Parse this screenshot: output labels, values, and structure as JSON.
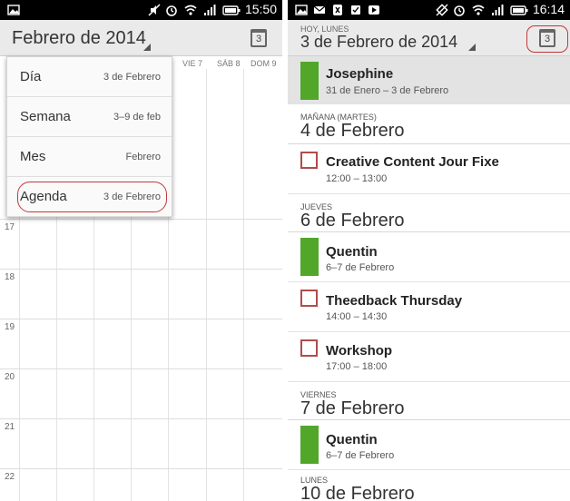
{
  "left": {
    "status": {
      "time": "15:50"
    },
    "header": {
      "title": "Febrero de 2014",
      "today_icon_day": "3"
    },
    "day_headers": [
      "VIE 7",
      "SÁB 8",
      "DOM 9"
    ],
    "hours": [
      "17",
      "18",
      "19",
      "20",
      "21",
      "22"
    ],
    "menu": [
      {
        "label": "Día",
        "value": "3 de Febrero"
      },
      {
        "label": "Semana",
        "value": "3–9 de feb"
      },
      {
        "label": "Mes",
        "value": "Febrero"
      },
      {
        "label": "Agenda",
        "value": "3 de Febrero"
      }
    ]
  },
  "right": {
    "status": {
      "time": "16:14"
    },
    "header": {
      "subtitle": "HOY, LUNES",
      "title": "3 de Febrero de 2014",
      "today_icon_day": "3"
    },
    "items": [
      {
        "kind": "event",
        "style": "bar",
        "title": "Josephine",
        "time": "31 de Enero – 3 de Febrero",
        "highlight": true
      },
      {
        "kind": "day",
        "small": "MAÑANA (MARTES)",
        "big": "4 de Febrero"
      },
      {
        "kind": "event",
        "style": "box",
        "title": "Creative Content Jour Fixe",
        "time": "12:00 – 13:00"
      },
      {
        "kind": "day",
        "small": "JUEVES",
        "big": "6 de Febrero"
      },
      {
        "kind": "event",
        "style": "bar",
        "title": "Quentin",
        "time": "6–7 de Febrero"
      },
      {
        "kind": "event",
        "style": "box",
        "title": "Theedback Thursday",
        "time": "14:00 – 14:30"
      },
      {
        "kind": "event",
        "style": "box",
        "title": "Workshop",
        "time": "17:00 – 18:00"
      },
      {
        "kind": "day",
        "small": "VIERNES",
        "big": "7 de Febrero"
      },
      {
        "kind": "event",
        "style": "bar",
        "title": "Quentin",
        "time": "6–7 de Febrero"
      },
      {
        "kind": "day",
        "small": "LUNES",
        "big": "10 de Febrero"
      }
    ]
  },
  "colors": {
    "event_green": "#52a62a",
    "event_box_border": "#b34b4b",
    "annotation_red": "#c0393b"
  }
}
